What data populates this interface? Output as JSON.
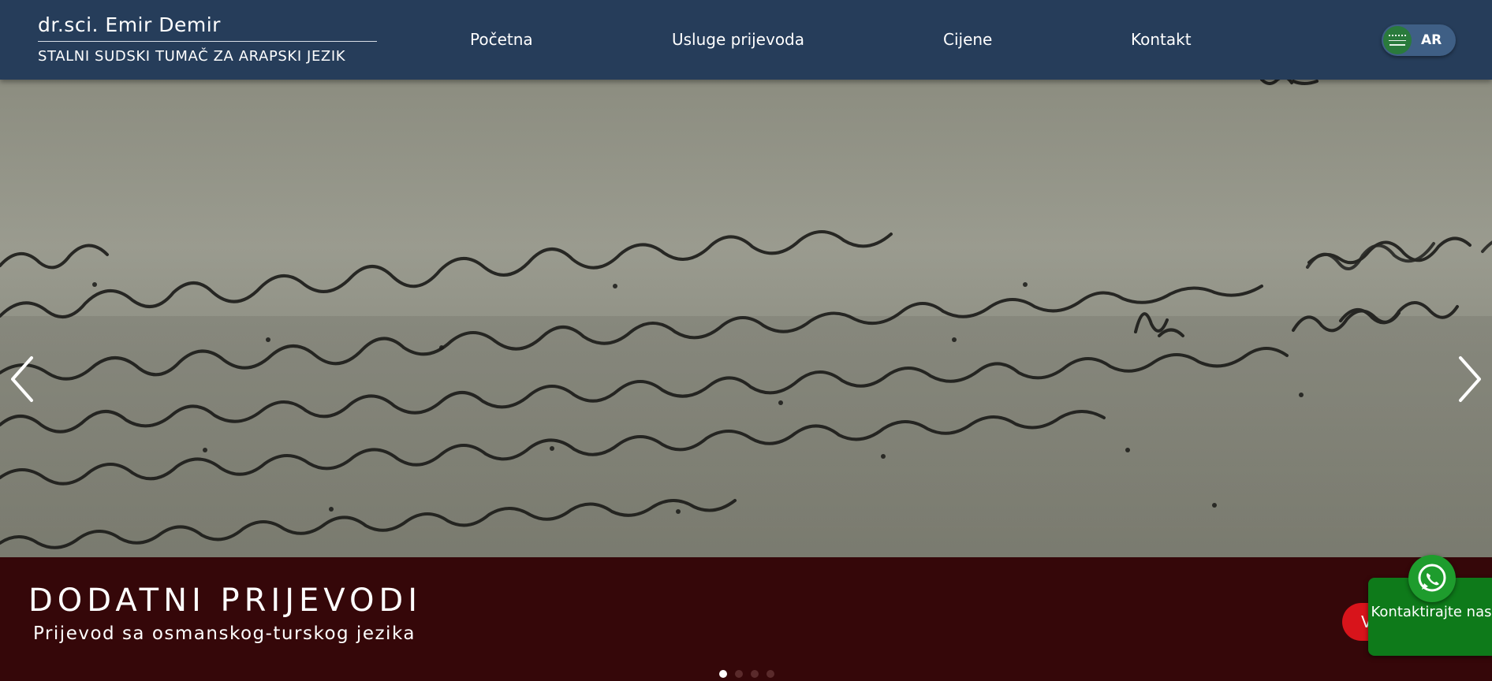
{
  "brand": {
    "name": "dr.sci. Emir Demir",
    "subtitle": "STALNI SUDSKI TUMAČ ZA ARAPSKI JEZIK"
  },
  "nav": {
    "items": [
      {
        "label": "Početna"
      },
      {
        "label": "Usluge prijevoda"
      },
      {
        "label": "Cijene"
      },
      {
        "label": "Kontakt"
      }
    ]
  },
  "language": {
    "code": "AR",
    "flag_icon": "saudi-arabia-flag-icon"
  },
  "hero": {
    "image_description_icon": "ottoman-turkish-manuscript",
    "prev_icon": "chevron-left-icon",
    "next_icon": "chevron-right-icon"
  },
  "caption": {
    "title": "DODATNI PRIJEVODI",
    "subtitle": "Prijevod sa osmanskog-turskog jezika",
    "button_label": "V"
  },
  "carousel": {
    "slide_count": 4,
    "active_index": 0
  },
  "whatsapp": {
    "label": "Kontaktirajte nas",
    "icon": "whatsapp-icon"
  },
  "colors": {
    "header_bg": "#263d5a",
    "caption_bg": "#350709",
    "cta_red": "#d8141b",
    "whatsapp_green": "#0e7a1a"
  }
}
